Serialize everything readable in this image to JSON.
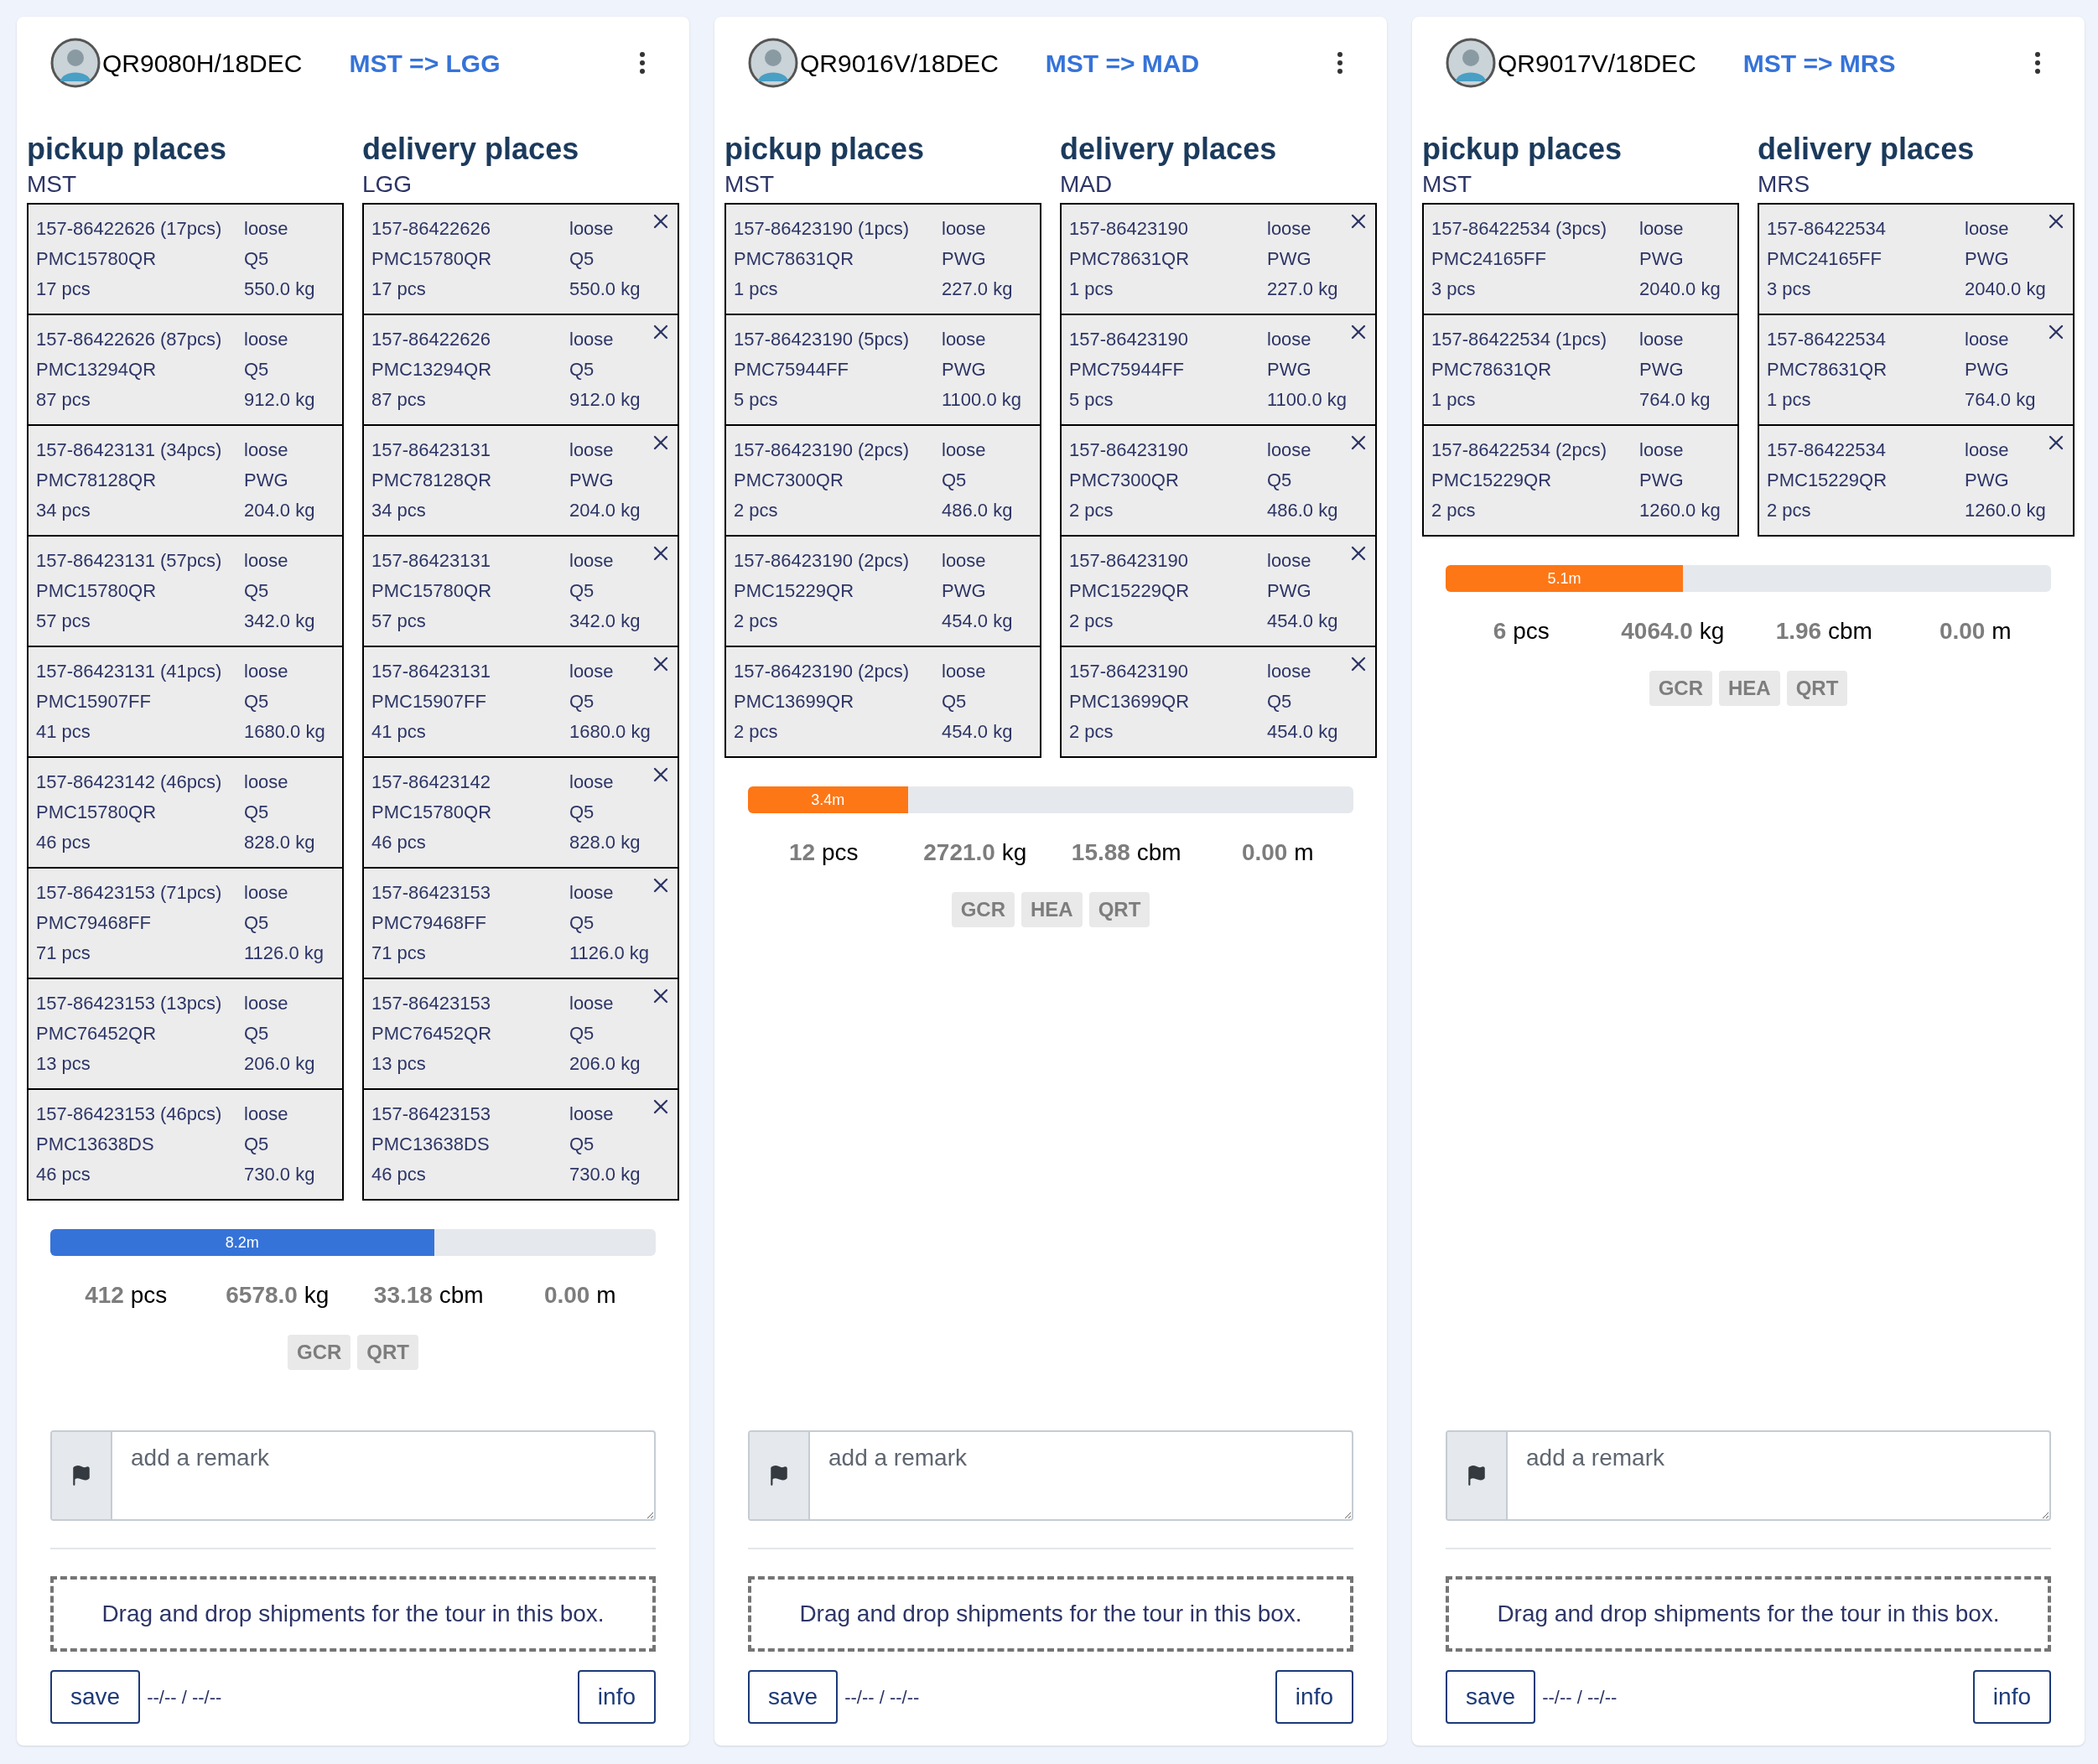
{
  "tours": [
    {
      "flight": "QR9080H/18DEC",
      "route": "MST => LGG",
      "pickup": {
        "title": "pickup places",
        "station": "MST",
        "shipments": [
          {
            "awb": "157-86422626 (17pcs)",
            "uld": "PMC15780QR",
            "pieces": "17 pcs",
            "loading": "loose",
            "type": "Q5",
            "weight": "550.0 kg"
          },
          {
            "awb": "157-86422626 (87pcs)",
            "uld": "PMC13294QR",
            "pieces": "87 pcs",
            "loading": "loose",
            "type": "Q5",
            "weight": "912.0 kg"
          },
          {
            "awb": "157-86423131 (34pcs)",
            "uld": "PMC78128QR",
            "pieces": "34 pcs",
            "loading": "loose",
            "type": "PWG",
            "weight": "204.0 kg"
          },
          {
            "awb": "157-86423131 (57pcs)",
            "uld": "PMC15780QR",
            "pieces": "57 pcs",
            "loading": "loose",
            "type": "Q5",
            "weight": "342.0 kg"
          },
          {
            "awb": "157-86423131 (41pcs)",
            "uld": "PMC15907FF",
            "pieces": "41 pcs",
            "loading": "loose",
            "type": "Q5",
            "weight": "1680.0 kg"
          },
          {
            "awb": "157-86423142 (46pcs)",
            "uld": "PMC15780QR",
            "pieces": "46 pcs",
            "loading": "loose",
            "type": "Q5",
            "weight": "828.0 kg"
          },
          {
            "awb": "157-86423153 (71pcs)",
            "uld": "PMC79468FF",
            "pieces": "71 pcs",
            "loading": "loose",
            "type": "Q5",
            "weight": "1126.0 kg"
          },
          {
            "awb": "157-86423153 (13pcs)",
            "uld": "PMC76452QR",
            "pieces": "13 pcs",
            "loading": "loose",
            "type": "Q5",
            "weight": "206.0 kg"
          },
          {
            "awb": "157-86423153 (46pcs)",
            "uld": "PMC13638DS",
            "pieces": "46 pcs",
            "loading": "loose",
            "type": "Q5",
            "weight": "730.0 kg"
          }
        ]
      },
      "delivery": {
        "title": "delivery places",
        "station": "LGG",
        "shipments": [
          {
            "awb": "157-86422626",
            "uld": "PMC15780QR",
            "pieces": "17 pcs",
            "loading": "loose",
            "type": "Q5",
            "weight": "550.0 kg"
          },
          {
            "awb": "157-86422626",
            "uld": "PMC13294QR",
            "pieces": "87 pcs",
            "loading": "loose",
            "type": "Q5",
            "weight": "912.0 kg"
          },
          {
            "awb": "157-86423131",
            "uld": "PMC78128QR",
            "pieces": "34 pcs",
            "loading": "loose",
            "type": "PWG",
            "weight": "204.0 kg"
          },
          {
            "awb": "157-86423131",
            "uld": "PMC15780QR",
            "pieces": "57 pcs",
            "loading": "loose",
            "type": "Q5",
            "weight": "342.0 kg"
          },
          {
            "awb": "157-86423131",
            "uld": "PMC15907FF",
            "pieces": "41 pcs",
            "loading": "loose",
            "type": "Q5",
            "weight": "1680.0 kg"
          },
          {
            "awb": "157-86423142",
            "uld": "PMC15780QR",
            "pieces": "46 pcs",
            "loading": "loose",
            "type": "Q5",
            "weight": "828.0 kg"
          },
          {
            "awb": "157-86423153",
            "uld": "PMC79468FF",
            "pieces": "71 pcs",
            "loading": "loose",
            "type": "Q5",
            "weight": "1126.0 kg"
          },
          {
            "awb": "157-86423153",
            "uld": "PMC76452QR",
            "pieces": "13 pcs",
            "loading": "loose",
            "type": "Q5",
            "weight": "206.0 kg"
          },
          {
            "awb": "157-86423153",
            "uld": "PMC13638DS",
            "pieces": "46 pcs",
            "loading": "loose",
            "type": "Q5",
            "weight": "730.0 kg"
          }
        ]
      },
      "progress": {
        "label": "8.2m",
        "level": 0.634,
        "color": "#3673d8"
      },
      "stats": [
        {
          "value": "412",
          "unit": "pcs"
        },
        {
          "value": "6578.0",
          "unit": "kg"
        },
        {
          "value": "33.18",
          "unit": "cbm"
        },
        {
          "value": "0.00",
          "unit": "m"
        }
      ],
      "tags": [
        "GCR",
        "QRT"
      ],
      "remark": {
        "placeholder": "add a remark"
      },
      "drop_text": "Drag and drop shipments for the tour in this box.",
      "save": "save",
      "date": "--/-- / --/--",
      "info": "info"
    },
    {
      "flight": "QR9016V/18DEC",
      "route": "MST => MAD",
      "pickup": {
        "title": "pickup places",
        "station": "MST",
        "shipments": [
          {
            "awb": "157-86423190 (1pcs)",
            "uld": "PMC78631QR",
            "pieces": "1 pcs",
            "loading": "loose",
            "type": "PWG",
            "weight": "227.0 kg"
          },
          {
            "awb": "157-86423190 (5pcs)",
            "uld": "PMC75944FF",
            "pieces": "5 pcs",
            "loading": "loose",
            "type": "PWG",
            "weight": "1100.0 kg"
          },
          {
            "awb": "157-86423190 (2pcs)",
            "uld": "PMC7300QR",
            "pieces": "2 pcs",
            "loading": "loose",
            "type": "Q5",
            "weight": "486.0 kg"
          },
          {
            "awb": "157-86423190 (2pcs)",
            "uld": "PMC15229QR",
            "pieces": "2 pcs",
            "loading": "loose",
            "type": "PWG",
            "weight": "454.0 kg"
          },
          {
            "awb": "157-86423190 (2pcs)",
            "uld": "PMC13699QR",
            "pieces": "2 pcs",
            "loading": "loose",
            "type": "Q5",
            "weight": "454.0 kg"
          }
        ]
      },
      "delivery": {
        "title": "delivery places",
        "station": "MAD",
        "shipments": [
          {
            "awb": "157-86423190",
            "uld": "PMC78631QR",
            "pieces": "1 pcs",
            "loading": "loose",
            "type": "PWG",
            "weight": "227.0 kg"
          },
          {
            "awb": "157-86423190",
            "uld": "PMC75944FF",
            "pieces": "5 pcs",
            "loading": "loose",
            "type": "PWG",
            "weight": "1100.0 kg"
          },
          {
            "awb": "157-86423190",
            "uld": "PMC7300QR",
            "pieces": "2 pcs",
            "loading": "loose",
            "type": "Q5",
            "weight": "486.0 kg"
          },
          {
            "awb": "157-86423190",
            "uld": "PMC15229QR",
            "pieces": "2 pcs",
            "loading": "loose",
            "type": "PWG",
            "weight": "454.0 kg"
          },
          {
            "awb": "157-86423190",
            "uld": "PMC13699QR",
            "pieces": "2 pcs",
            "loading": "loose",
            "type": "Q5",
            "weight": "454.0 kg"
          }
        ]
      },
      "progress": {
        "label": "3.4m",
        "level": 0.264,
        "color": "#fd7716"
      },
      "stats": [
        {
          "value": "12",
          "unit": "pcs"
        },
        {
          "value": "2721.0",
          "unit": "kg"
        },
        {
          "value": "15.88",
          "unit": "cbm"
        },
        {
          "value": "0.00",
          "unit": "m"
        }
      ],
      "tags": [
        "GCR",
        "HEA",
        "QRT"
      ],
      "remark": {
        "placeholder": "add a remark"
      },
      "drop_text": "Drag and drop shipments for the tour in this box.",
      "save": "save",
      "date": "--/-- / --/--",
      "info": "info"
    },
    {
      "flight": "QR9017V/18DEC",
      "route": "MST => MRS",
      "pickup": {
        "title": "pickup places",
        "station": "MST",
        "shipments": [
          {
            "awb": "157-86422534 (3pcs)",
            "uld": "PMC24165FF",
            "pieces": "3 pcs",
            "loading": "loose",
            "type": "PWG",
            "weight": "2040.0 kg"
          },
          {
            "awb": "157-86422534 (1pcs)",
            "uld": "PMC78631QR",
            "pieces": "1 pcs",
            "loading": "loose",
            "type": "PWG",
            "weight": "764.0 kg"
          },
          {
            "awb": "157-86422534 (2pcs)",
            "uld": "PMC15229QR",
            "pieces": "2 pcs",
            "loading": "loose",
            "type": "PWG",
            "weight": "1260.0 kg"
          }
        ]
      },
      "delivery": {
        "title": "delivery places",
        "station": "MRS",
        "shipments": [
          {
            "awb": "157-86422534",
            "uld": "PMC24165FF",
            "pieces": "3 pcs",
            "loading": "loose",
            "type": "PWG",
            "weight": "2040.0 kg"
          },
          {
            "awb": "157-86422534",
            "uld": "PMC78631QR",
            "pieces": "1 pcs",
            "loading": "loose",
            "type": "PWG",
            "weight": "764.0 kg"
          },
          {
            "awb": "157-86422534",
            "uld": "PMC15229QR",
            "pieces": "2 pcs",
            "loading": "loose",
            "type": "PWG",
            "weight": "1260.0 kg"
          }
        ]
      },
      "progress": {
        "label": "5.1m",
        "level": 0.392,
        "color": "#fd7716"
      },
      "stats": [
        {
          "value": "6",
          "unit": "pcs"
        },
        {
          "value": "4064.0",
          "unit": "kg"
        },
        {
          "value": "1.96",
          "unit": "cbm"
        },
        {
          "value": "0.00",
          "unit": "m"
        }
      ],
      "tags": [
        "GCR",
        "HEA",
        "QRT"
      ],
      "remark": {
        "placeholder": "add a remark"
      },
      "drop_text": "Drag and drop shipments for the tour in this box.",
      "save": "save",
      "date": "--/-- / --/--",
      "info": "info"
    }
  ]
}
